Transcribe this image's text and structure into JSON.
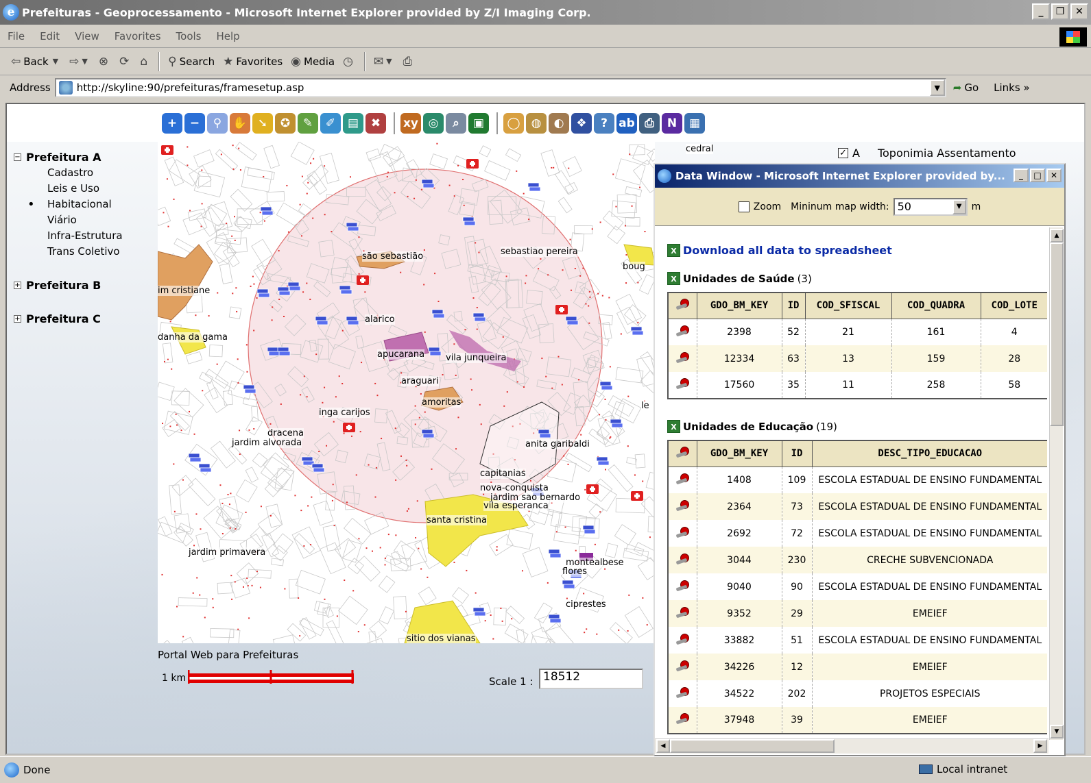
{
  "window": {
    "title": "Prefeituras - Geoprocessamento - Microsoft Internet Explorer provided by Z/I Imaging Corp.",
    "buttons": [
      "_",
      "Ɖ",
      "X"
    ]
  },
  "menu": [
    "File",
    "Edit",
    "View",
    "Favorites",
    "Tools",
    "Help"
  ],
  "toolbar": {
    "back": "Back",
    "search": "Search",
    "favorites": "Favorites",
    "media": "Media"
  },
  "address": {
    "label": "Address",
    "url": "http://skyline:90/prefeituras/framesetup.asp",
    "go": "Go",
    "links": "Links"
  },
  "tree": {
    "a": {
      "label": "Prefeitura A",
      "expander": "−",
      "items": [
        "Cadastro",
        "Leis e Uso",
        "Habitacional",
        "Viário",
        "Infra-Estrutura",
        "Trans Coletivo"
      ],
      "selected_index": 2
    },
    "b": {
      "label": "Prefeitura B",
      "expander": "+"
    },
    "c": {
      "label": "Prefeitura C",
      "expander": "+"
    }
  },
  "map_labels": [
    "são sebastião",
    "sebastiao pereira",
    "im cristiane",
    "alarico",
    "danha da gama",
    "apucarana",
    "vila junqueira",
    "araguari",
    "amoritas",
    "inga carijos",
    "dracena",
    "jardim alvorada",
    "anita garibaldi",
    "capitanias",
    "nova-conquista",
    "jardim sao bernardo",
    "vila esperanca",
    "santa cristina",
    "jardim primavera",
    "montealbese",
    "flores",
    "ciprestes",
    "sitio dos vianas",
    "boug",
    "le"
  ],
  "footer": {
    "portal": "Portal Web para Prefeituras",
    "scale_km": "1 km",
    "scale_label": "Scale  1 :",
    "scale_value": "18512"
  },
  "behind": {
    "cedral": "cedral",
    "topo_letter": "A",
    "topo_label": "Toponimia Assentamento",
    "topo_check": "✓"
  },
  "datawin": {
    "title": "Data Window - Microsoft Internet Explorer provided by...",
    "zoom_label": "Zoom",
    "min_width_label": "Mininum map width:",
    "min_width_value": "50",
    "unit": "m",
    "download": "Download all data to spreadsheet",
    "saude": {
      "title": "Unidades de Saúde",
      "count": "(3)",
      "columns": [
        "GDO_BM_KEY",
        "ID",
        "COD_SFISCAL",
        "COD_QUADRA",
        "COD_LOTE"
      ],
      "rows": [
        [
          "2398",
          "52",
          "21",
          "161",
          "4"
        ],
        [
          "12334",
          "63",
          "13",
          "159",
          "28"
        ],
        [
          "17560",
          "35",
          "11",
          "258",
          "58"
        ]
      ]
    },
    "educacao": {
      "title": "Unidades de Educação",
      "count": "(19)",
      "columns": [
        "GDO_BM_KEY",
        "ID",
        "DESC_TIPO_EDUCACAO"
      ],
      "rows": [
        [
          "1408",
          "109",
          "ESCOLA ESTADUAL DE ENSINO FUNDAMENTAL"
        ],
        [
          "2364",
          "73",
          "ESCOLA ESTADUAL DE ENSINO FUNDAMENTAL"
        ],
        [
          "2692",
          "72",
          "ESCOLA ESTADUAL DE ENSINO FUNDAMENTAL"
        ],
        [
          "3044",
          "230",
          "CRECHE SUBVENCIONADA"
        ],
        [
          "9040",
          "90",
          "ESCOLA ESTADUAL DE ENSINO FUNDAMENTAL"
        ],
        [
          "9352",
          "29",
          "EMEIEF"
        ],
        [
          "33882",
          "51",
          "ESCOLA ESTADUAL DE ENSINO FUNDAMENTAL"
        ],
        [
          "34226",
          "12",
          "EMEIEF"
        ],
        [
          "34522",
          "202",
          "PROJETOS ESPECIAIS"
        ],
        [
          "37948",
          "39",
          "EMEIEF"
        ]
      ]
    }
  },
  "status": {
    "text": "Done",
    "zone": "Local intranet"
  },
  "colors": {
    "health": "#e02020",
    "education": "#3a4fd0",
    "favela": "#e0a060",
    "area_yellow": "#f2e64a",
    "area_pink": "#c070b0",
    "buffer": "#f3d0d6"
  }
}
